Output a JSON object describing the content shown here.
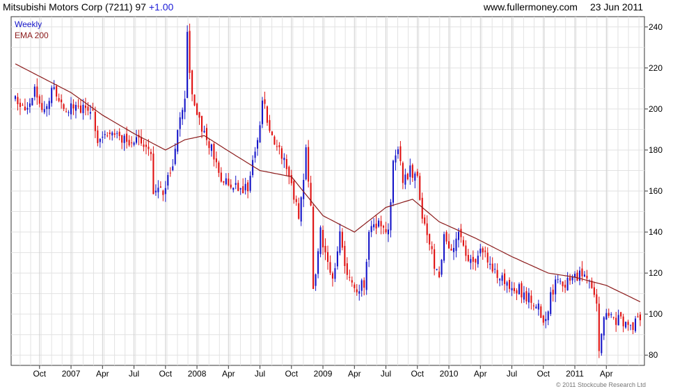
{
  "header": {
    "name": "Mitsubishi Motors Corp",
    "ticker": "(7211)",
    "price": "97",
    "change": "+1.00",
    "site": "www.fullermoney.com",
    "date": "23 Jun 2011"
  },
  "footer": {
    "copyright": "© 2011 Stockcube Research Ltd"
  },
  "colors": {
    "up": "#1414c8",
    "down": "#e01010",
    "ema": "#8b1a1a",
    "grid": "#e2e2e2",
    "frame": "#333333"
  },
  "chart_data": {
    "type": "candlestick",
    "legend": [
      {
        "label": "Weekly",
        "color": "#1414c8"
      },
      {
        "label": "EMA 200",
        "color": "#8b1a1a"
      }
    ],
    "ylim": [
      75,
      245
    ],
    "y_ticks": [
      80,
      100,
      120,
      140,
      160,
      180,
      200,
      220,
      240
    ],
    "x_range": [
      0,
      258
    ],
    "x_ticks": [
      {
        "label": "Oct",
        "week": 10
      },
      {
        "label": "2007",
        "week": 23
      },
      {
        "label": "Apr",
        "week": 36
      },
      {
        "label": "Jul",
        "week": 49
      },
      {
        "label": "Oct",
        "week": 62
      },
      {
        "label": "2008",
        "week": 75
      },
      {
        "label": "Apr",
        "week": 88
      },
      {
        "label": "Jul",
        "week": 101
      },
      {
        "label": "Oct",
        "week": 114
      },
      {
        "label": "2009",
        "week": 127
      },
      {
        "label": "Apr",
        "week": 140
      },
      {
        "label": "Jul",
        "week": 153
      },
      {
        "label": "Oct",
        "week": 166
      },
      {
        "label": "2010",
        "week": 179
      },
      {
        "label": "Apr",
        "week": 192
      },
      {
        "label": "Jul",
        "week": 205
      },
      {
        "label": "Oct",
        "week": 218
      },
      {
        "label": "2011",
        "week": 231
      },
      {
        "label": "Apr",
        "week": 244
      }
    ],
    "ema_keypoints": [
      [
        0,
        222
      ],
      [
        23,
        208
      ],
      [
        36,
        197
      ],
      [
        49,
        188
      ],
      [
        62,
        180
      ],
      [
        70,
        185
      ],
      [
        78,
        187
      ],
      [
        90,
        178
      ],
      [
        101,
        170
      ],
      [
        114,
        167
      ],
      [
        127,
        148
      ],
      [
        140,
        140
      ],
      [
        153,
        152
      ],
      [
        164,
        156
      ],
      [
        175,
        145
      ],
      [
        190,
        137
      ],
      [
        205,
        128
      ],
      [
        220,
        120
      ],
      [
        231,
        118
      ],
      [
        244,
        114
      ],
      [
        258,
        106
      ]
    ],
    "close_keypoints": [
      [
        0,
        205
      ],
      [
        5,
        200
      ],
      [
        8,
        210
      ],
      [
        12,
        200
      ],
      [
        16,
        210
      ],
      [
        20,
        200
      ],
      [
        24,
        202
      ],
      [
        28,
        200
      ],
      [
        32,
        198
      ],
      [
        34,
        185
      ],
      [
        40,
        188
      ],
      [
        44,
        186
      ],
      [
        48,
        185
      ],
      [
        52,
        183
      ],
      [
        56,
        180
      ],
      [
        57,
        158
      ],
      [
        61,
        160
      ],
      [
        63,
        165
      ],
      [
        66,
        180
      ],
      [
        68,
        195
      ],
      [
        70,
        205
      ],
      [
        71,
        235
      ],
      [
        73,
        205
      ],
      [
        76,
        195
      ],
      [
        79,
        185
      ],
      [
        82,
        178
      ],
      [
        84,
        168
      ],
      [
        88,
        165
      ],
      [
        92,
        160
      ],
      [
        96,
        162
      ],
      [
        100,
        185
      ],
      [
        102,
        205
      ],
      [
        105,
        190
      ],
      [
        108,
        183
      ],
      [
        111,
        175
      ],
      [
        114,
        165
      ],
      [
        117,
        145
      ],
      [
        120,
        180
      ],
      [
        122,
        150
      ],
      [
        123,
        110
      ],
      [
        126,
        140
      ],
      [
        128,
        130
      ],
      [
        131,
        118
      ],
      [
        134,
        138
      ],
      [
        137,
        118
      ],
      [
        140,
        113
      ],
      [
        144,
        115
      ],
      [
        146,
        140
      ],
      [
        150,
        145
      ],
      [
        154,
        140
      ],
      [
        156,
        175
      ],
      [
        158,
        180
      ],
      [
        160,
        165
      ],
      [
        163,
        170
      ],
      [
        166,
        165
      ],
      [
        168,
        145
      ],
      [
        172,
        130
      ],
      [
        175,
        115
      ],
      [
        177,
        140
      ],
      [
        180,
        130
      ],
      [
        183,
        140
      ],
      [
        186,
        128
      ],
      [
        190,
        125
      ],
      [
        193,
        132
      ],
      [
        196,
        122
      ],
      [
        200,
        117
      ],
      [
        204,
        115
      ],
      [
        208,
        112
      ],
      [
        212,
        108
      ],
      [
        216,
        103
      ],
      [
        219,
        95
      ],
      [
        221,
        108
      ],
      [
        224,
        118
      ],
      [
        228,
        115
      ],
      [
        231,
        118
      ],
      [
        235,
        119
      ],
      [
        239,
        112
      ],
      [
        240,
        108
      ],
      [
        241,
        84
      ],
      [
        243,
        100
      ],
      [
        246,
        97
      ],
      [
        250,
        97
      ],
      [
        253,
        94
      ],
      [
        258,
        97
      ]
    ]
  }
}
